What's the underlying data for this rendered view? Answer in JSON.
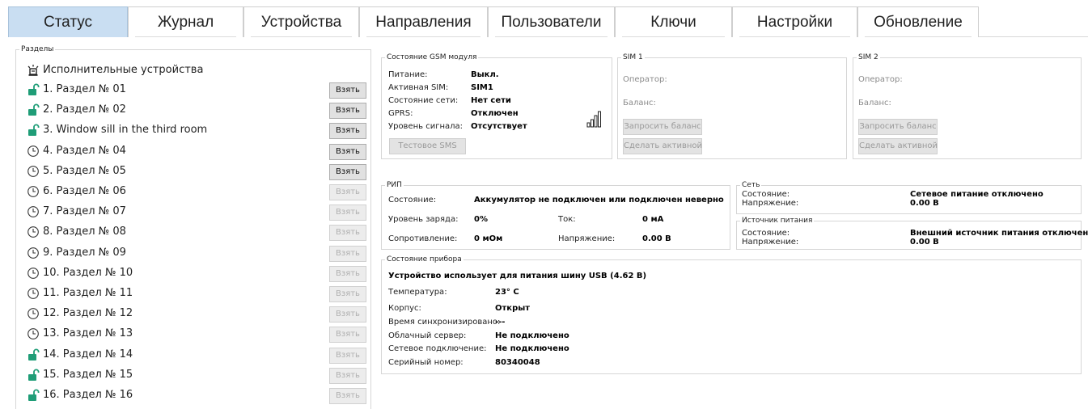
{
  "tabs": [
    "Статус",
    "Журнал",
    "Устройства",
    "Направления",
    "Пользователи",
    "Ключи",
    "Настройки",
    "Обновление"
  ],
  "sections": {
    "legend": "Разделы",
    "header": "Исполнительные устройства",
    "take_label": "Взять",
    "items": [
      {
        "label": "1. Раздел № 01",
        "icon": "unlock-icon",
        "enabled": true
      },
      {
        "label": "2. Раздел № 02",
        "icon": "unlock-icon",
        "enabled": true
      },
      {
        "label": "3. Window sill in the third room",
        "icon": "unlock-icon",
        "enabled": true
      },
      {
        "label": "4. Раздел № 04",
        "icon": "clock-icon",
        "enabled": true
      },
      {
        "label": "5. Раздел № 05",
        "icon": "clock-icon",
        "enabled": true
      },
      {
        "label": "6. Раздел № 06",
        "icon": "clock-icon",
        "enabled": false
      },
      {
        "label": "7. Раздел № 07",
        "icon": "clock-icon",
        "enabled": false
      },
      {
        "label": "8. Раздел № 08",
        "icon": "clock-icon",
        "enabled": false
      },
      {
        "label": "9. Раздел № 09",
        "icon": "clock-icon",
        "enabled": false
      },
      {
        "label": "10. Раздел № 10",
        "icon": "clock-icon",
        "enabled": false
      },
      {
        "label": "11. Раздел № 11",
        "icon": "clock-icon",
        "enabled": false
      },
      {
        "label": "12. Раздел № 12",
        "icon": "clock-icon",
        "enabled": false
      },
      {
        "label": "13. Раздел № 13",
        "icon": "clock-icon",
        "enabled": false
      },
      {
        "label": "14. Раздел № 14",
        "icon": "unlock-icon",
        "enabled": false
      },
      {
        "label": "15. Раздел № 15",
        "icon": "unlock-icon",
        "enabled": false
      },
      {
        "label": "16. Раздел № 16",
        "icon": "unlock-icon",
        "enabled": false
      }
    ]
  },
  "gsm": {
    "legend": "Состояние GSM модуля",
    "power_label": "Питание:",
    "power_value": "Выкл.",
    "sim_label": "Активная SIM:",
    "sim_value": "SIM1",
    "net_label": "Состояние сети:",
    "net_value": "Нет сети",
    "gprs_label": "GPRS:",
    "gprs_value": "Отключен",
    "signal_label": "Уровень сигнала:",
    "signal_value": "Отсутствует",
    "test_sms": "Тестовое SMS"
  },
  "sim1": {
    "legend": "SIM 1",
    "operator": "Оператор:",
    "balance": "Баланс:",
    "request": "Запросить баланс",
    "activate": "Сделать активной"
  },
  "sim2": {
    "legend": "SIM 2",
    "operator": "Оператор:",
    "balance": "Баланс:",
    "request": "Запросить баланс",
    "activate": "Сделать активной"
  },
  "rip": {
    "legend": "РИП",
    "state_label": "Состояние:",
    "state_value": "Аккумулятор не подключен или подключен неверно",
    "charge_label": "Уровень заряда:",
    "charge_value": "0%",
    "current_label": "Ток:",
    "current_value": "0 мА",
    "resist_label": "Сопротивление:",
    "resist_value": "0 мОм",
    "voltage_label": "Напряжение:",
    "voltage_value": "0.00 В"
  },
  "net": {
    "legend": "Сеть",
    "state_label": "Состояние:",
    "state_value": "Сетевое питание отключено",
    "voltage_label": "Напряжение:",
    "voltage_value": "0.00 В"
  },
  "psu": {
    "legend": "Источник питания",
    "state_label": "Состояние:",
    "state_value": "Внешний источник питания отключен",
    "voltage_label": "Напряжение:",
    "voltage_value": "0.00 В"
  },
  "device": {
    "legend": "Состояние прибора",
    "headline": "Устройство использует для питания шину USB (4.62 В)",
    "temp_label": "Температура:",
    "temp_value": "23° С",
    "case_label": "Корпус:",
    "case_value": "Открыт",
    "sync_label": "Время синхронизировано:",
    "sync_value": "---",
    "cloud_label": "Облачный сервер:",
    "cloud_value": "Не подключено",
    "netconn_label": "Сетевое подключение:",
    "netconn_value": "Не подключено",
    "serial_label": "Серийный номер:",
    "serial_value": "80340048"
  }
}
